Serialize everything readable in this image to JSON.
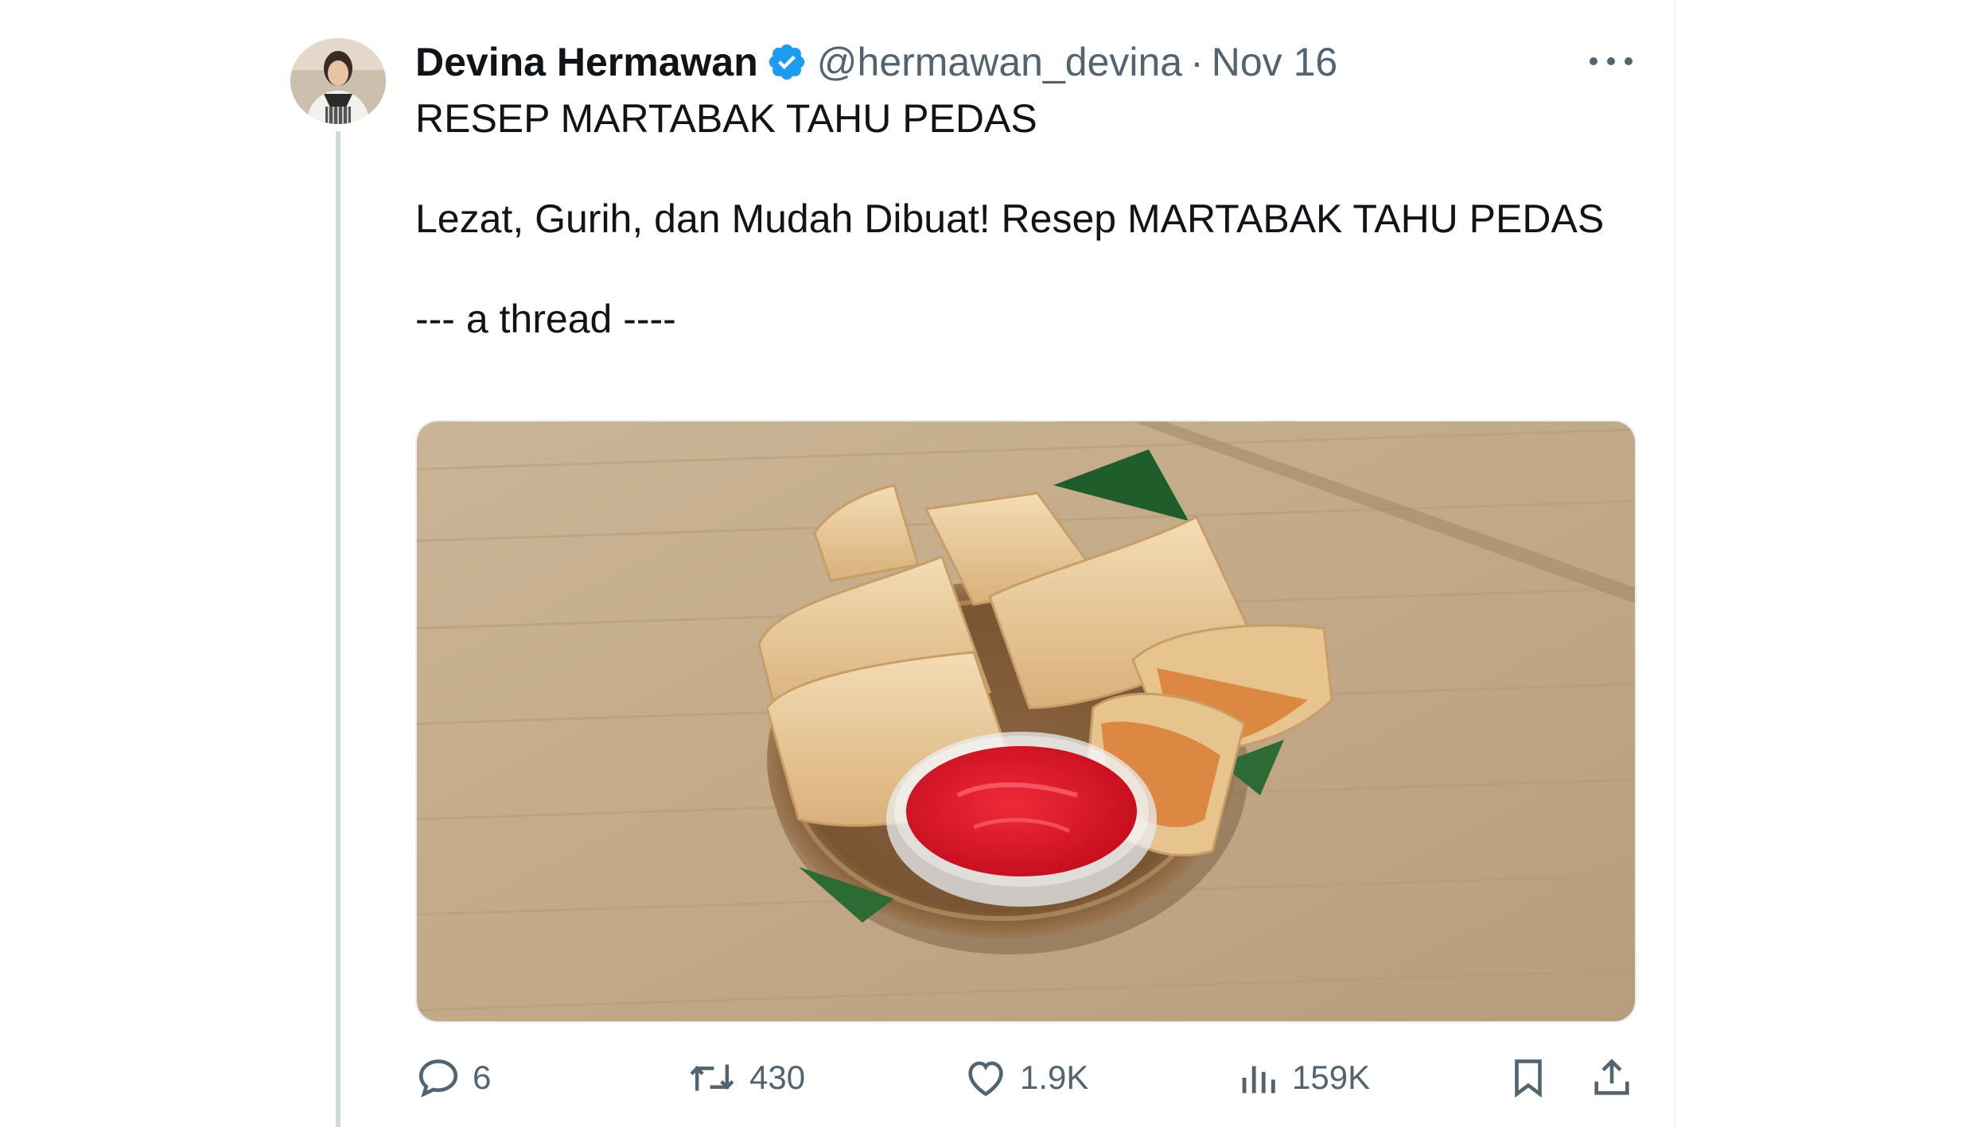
{
  "tweet": {
    "author_name": "Devina Hermawan",
    "handle": "@hermawan_devina",
    "separator": "·",
    "date": "Nov 16",
    "lines": [
      "RESEP MARTABAK TAHU PEDAS",
      "Lezat, Gurih, dan Mudah Dibuat! Resep MARTABAK TAHU PEDAS",
      "--- a thread ----"
    ],
    "media_alt": "Martabak tahu pedas on a bamboo plate with red chili sauce"
  },
  "actions": {
    "replies": "6",
    "retweets": "430",
    "likes": "1.9K",
    "views": "159K"
  },
  "icons": {
    "more": "more-horizontal-icon",
    "verified": "verified-badge-icon",
    "reply": "reply-icon",
    "retweet": "retweet-icon",
    "like": "heart-icon",
    "views": "views-icon",
    "bookmark": "bookmark-icon",
    "share": "share-icon"
  },
  "colors": {
    "verified": "#1d9bf0",
    "text_primary": "#0f1419",
    "text_secondary": "#536471",
    "thread_line": "#cfd9de"
  }
}
